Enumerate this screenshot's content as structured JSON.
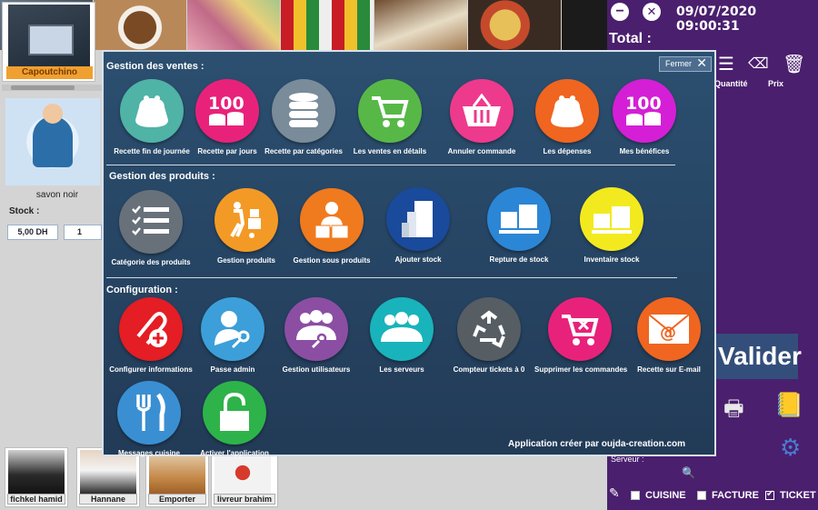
{
  "left_panel": {
    "top_product_label": "Capoutchino",
    "product_label": "savon noir",
    "stock_label": "Stock :",
    "price": "5,00 DH",
    "quantity": "1"
  },
  "servers": [
    "fichkel hamid",
    "Hannane",
    "Emporter",
    "livreur brahim"
  ],
  "right_panel": {
    "datetime": "09/07/2020 09:00:31",
    "total_label": "Total :",
    "col_quantity": "Quantité",
    "col_price": "Prix",
    "validate_label": "Valider",
    "server_select": "Serveur :",
    "checks": {
      "cuisine": "CUISINE",
      "facture": "FACTURE",
      "ticket": "TICKET"
    }
  },
  "modal": {
    "close_label": "Fermer",
    "sections": {
      "ventes": "Gestion des ventes :",
      "produits": "Gestion des produits :",
      "configuration": "Configuration :"
    },
    "ventes_items": [
      {
        "label": "Recette fin de journée",
        "color": "#4fb3a6"
      },
      {
        "label": "Recette par jours",
        "color": "#e8227a"
      },
      {
        "label": "Recette par catégories",
        "color": "#7a8b99"
      },
      {
        "label": "Les ventes en détails",
        "color": "#57b848"
      },
      {
        "label": "Annuler  commande",
        "color": "#ee3a8c"
      },
      {
        "label": "Les dépenses",
        "color": "#f0651f"
      },
      {
        "label": "Mes bénéfices",
        "color": "#d41fd6"
      }
    ],
    "produits_items": [
      {
        "label": "Catégorie des produits",
        "color": "#68717a"
      },
      {
        "label": "Gestion produits",
        "color": "#f39a26"
      },
      {
        "label": "Gestion sous produits",
        "color": "#f07a1e"
      },
      {
        "label": "Ajouter stock",
        "color": "#1a4a9b"
      },
      {
        "label": "Repture de stock",
        "color": "#2b86d6"
      },
      {
        "label": "Inventaire stock",
        "color": "#f2ea1f"
      }
    ],
    "config_items": [
      {
        "label": "Configurer informations",
        "color": "#e51d24"
      },
      {
        "label": "Passe admin",
        "color": "#3c9fd9"
      },
      {
        "label": "Gestion utilisateurs",
        "color": "#8b4ea3"
      },
      {
        "label": "Les serveurs",
        "color": "#19b3bb"
      },
      {
        "label": "Compteur tickets à 0",
        "color": "#565d63"
      },
      {
        "label": "Supprimer les commandes",
        "color": "#e8227a"
      },
      {
        "label": "Recette sur E-mail",
        "color": "#f0651f"
      },
      {
        "label": "Messages cuisine",
        "color": "#3a8fd2"
      },
      {
        "label": "Activer l'application",
        "color": "#2eb34a"
      }
    ],
    "footer": "Application créer par oujda-creation.com"
  },
  "colors": {
    "panel_purple": "#4a1f6e",
    "modal_blue": "#274665",
    "validate_blue": "#334e7a",
    "accent_orange": "#f0a030"
  }
}
